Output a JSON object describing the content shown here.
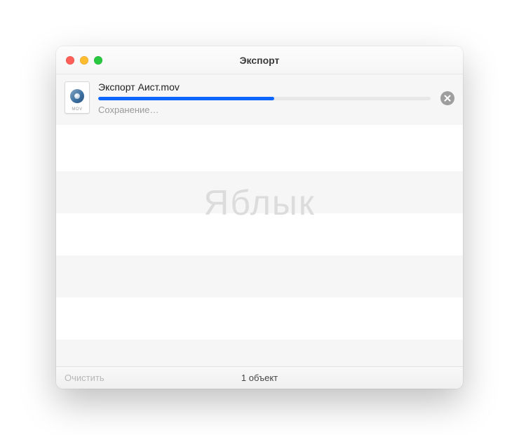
{
  "window": {
    "title": "Экспорт"
  },
  "item": {
    "filename": "Экспорт Аист.mov",
    "file_ext_label": "MOV",
    "status": "Сохранение…",
    "progress_percent": 53
  },
  "footer": {
    "clear_label": "Очистить",
    "count_label": "1 объект"
  },
  "watermark": {
    "text": "Яблык"
  },
  "colors": {
    "progress": "#0a66ff"
  }
}
